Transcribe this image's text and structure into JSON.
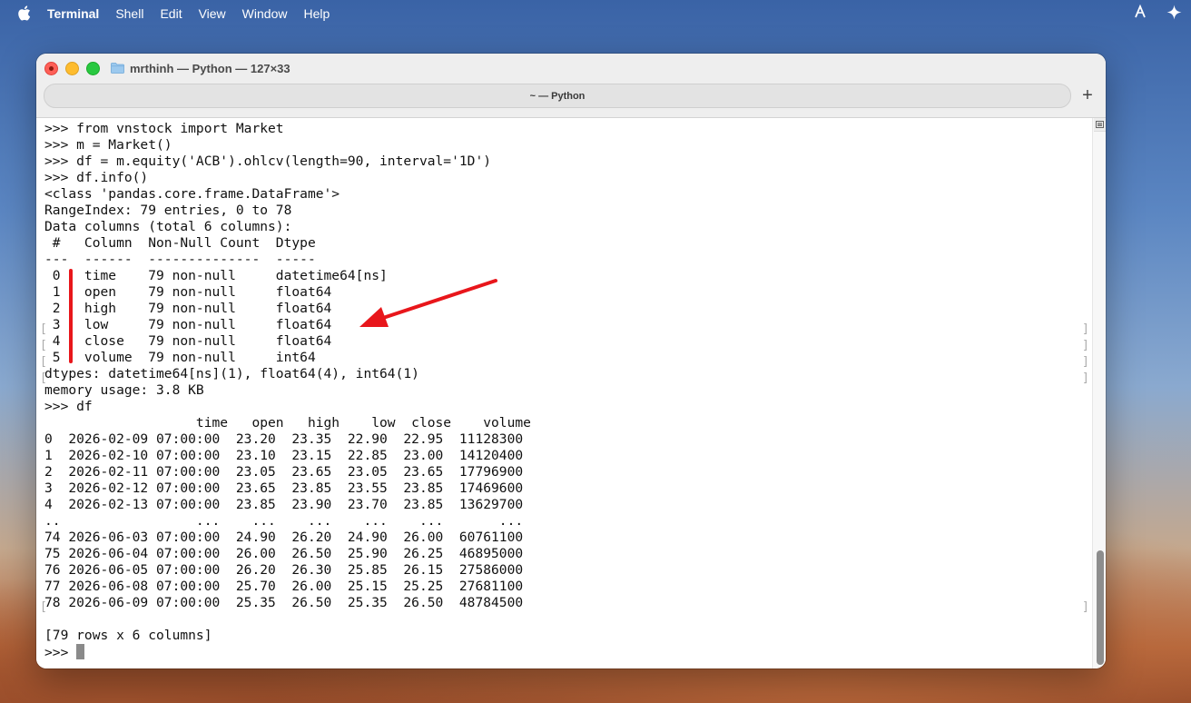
{
  "menubar": {
    "app": "Terminal",
    "items": [
      "Shell",
      "Edit",
      "View",
      "Window",
      "Help"
    ]
  },
  "window": {
    "title": "mrthinh — Python — 127×33",
    "tab_title": "~ — Python",
    "new_tab_label": "+"
  },
  "terminal": {
    "lines": [
      ">>> from vnstock import Market",
      ">>> m = Market()",
      ">>> df = m.equity('ACB').ohlcv(length=90, interval='1D')",
      ">>> df.info()",
      "<class 'pandas.core.frame.DataFrame'>",
      "RangeIndex: 79 entries, 0 to 78",
      "Data columns (total 6 columns):",
      " #   Column  Non-Null Count  Dtype",
      "---  ------  --------------  -----",
      " 0   time    79 non-null     datetime64[ns]",
      " 1   open    79 non-null     float64",
      " 2   high    79 non-null     float64",
      " 3   low     79 non-null     float64",
      " 4   close   79 non-null     float64",
      " 5   volume  79 non-null     int64",
      "dtypes: datetime64[ns](1), float64(4), int64(1)",
      "memory usage: 3.8 KB",
      ">>> df",
      "                   time   open   high    low  close    volume",
      "0  2026-02-09 07:00:00  23.20  23.35  22.90  22.95  11128300",
      "1  2026-02-10 07:00:00  23.10  23.15  22.85  23.00  14120400",
      "2  2026-02-11 07:00:00  23.05  23.65  23.05  23.65  17796900",
      "3  2026-02-12 07:00:00  23.65  23.85  23.55  23.85  17469600",
      "4  2026-02-13 07:00:00  23.85  23.90  23.70  23.85  13629700",
      "..                 ...    ...    ...    ...    ...       ...",
      "74 2026-06-03 07:00:00  24.90  26.20  24.90  26.00  60761100",
      "75 2026-06-04 07:00:00  26.00  26.50  25.90  26.25  46895000",
      "76 2026-06-05 07:00:00  26.20  26.30  25.85  26.15  27586000",
      "77 2026-06-08 07:00:00  25.70  26.00  25.15  25.25  27681100",
      "78 2026-06-09 07:00:00  25.35  26.50  25.35  26.50  48784500",
      "",
      "[79 rows x 6 columns]",
      ">>> "
    ]
  },
  "colors": {
    "annotation_red": "#e8161b"
  }
}
